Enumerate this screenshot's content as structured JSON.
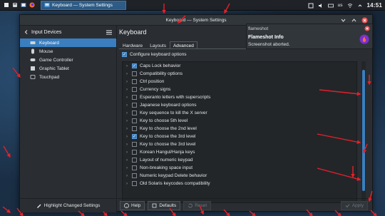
{
  "panel": {
    "task_title": "Keyboard — System Settings",
    "tray": {
      "lang": "us",
      "clock": "14:51"
    },
    "icons": [
      "app-launcher-icon",
      "files-icon",
      "terminal-icon",
      "browser-icon",
      "settings-icon",
      "volume-icon",
      "keyboard-icon",
      "network-icon",
      "expand-tray-icon"
    ]
  },
  "window": {
    "title": "Keyboard — System Settings"
  },
  "sidebar": {
    "header": "Input Devices",
    "items": [
      {
        "label": "Keyboard",
        "icon": "keyboard-icon",
        "selected": true
      },
      {
        "label": "Mouse",
        "icon": "mouse-icon",
        "selected": false
      },
      {
        "label": "Game Controller",
        "icon": "gamepad-icon",
        "selected": false
      },
      {
        "label": "Graphic Tablet",
        "icon": "tablet-icon",
        "selected": false
      },
      {
        "label": "Touchpad",
        "icon": "touchpad-icon",
        "selected": false
      }
    ],
    "footer": "Highlight Changed Settings"
  },
  "main": {
    "title": "Keyboard",
    "tabs": [
      "Hardware",
      "Layouts",
      "Advanced"
    ],
    "active_tab": "Advanced",
    "configure_label": "Configure keyboard options",
    "options": [
      {
        "label": "Caps Lock behavior",
        "checked": true
      },
      {
        "label": "Compatibility options",
        "checked": false
      },
      {
        "label": "Ctrl position",
        "checked": false
      },
      {
        "label": "Currency signs",
        "checked": false
      },
      {
        "label": "Esperanto letters with superscripts",
        "checked": false
      },
      {
        "label": "Japanese keyboard options",
        "checked": false
      },
      {
        "label": "Key sequence to kill the X server",
        "checked": false
      },
      {
        "label": "Key to choose 5th level",
        "checked": false
      },
      {
        "label": "Key to choose the 2nd level",
        "checked": false
      },
      {
        "label": "Key to choose the 3rd level",
        "checked": true
      },
      {
        "label": "Key to choose the 3rd level",
        "checked": false
      },
      {
        "label": "Korean Hangul/Hanja keys",
        "checked": false
      },
      {
        "label": "Layout of numeric keypad",
        "checked": false
      },
      {
        "label": "Non-breaking space input",
        "checked": false
      },
      {
        "label": "Numeric keypad Delete behavior",
        "checked": false
      },
      {
        "label": "Old Solaris keycodes compatibility",
        "checked": false
      }
    ],
    "buttons": {
      "help": "Help",
      "defaults": "Defaults",
      "reset": "Reset",
      "apply": "Apply"
    }
  },
  "notification": {
    "app": "flameshot",
    "title": "Flameshot Info",
    "body": "Screenshot aborted."
  },
  "colors": {
    "accent": "#3a7ebf",
    "arrow": "#e8202a",
    "panel": "#1f2226",
    "window_bg": "#2a2e32"
  }
}
